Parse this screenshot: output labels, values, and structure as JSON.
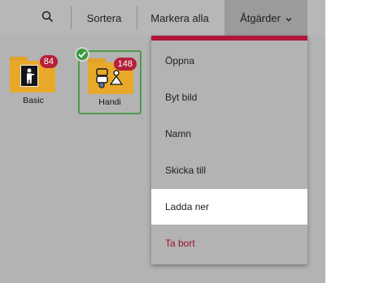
{
  "toolbar": {
    "search_icon": "search-icon",
    "sort_label": "Sortera",
    "mark_all_label": "Markera alla",
    "actions_label": "Åtgärder",
    "actions_icon": "chevron-down-icon"
  },
  "folders": [
    {
      "label": "Basic",
      "count": "84",
      "selected": false
    },
    {
      "label": "Handi",
      "count": "148",
      "selected": true
    }
  ],
  "actions_menu": {
    "items": [
      {
        "label": "Öppna"
      },
      {
        "label": "Byt bild"
      },
      {
        "label": "Namn"
      },
      {
        "label": "Skicka till"
      },
      {
        "label": "Ladda ner",
        "highlighted": true
      },
      {
        "label": "Ta bort",
        "danger": true
      }
    ],
    "accent_color": "#b0183a"
  },
  "colors": {
    "badge": "#b4203a",
    "selected_border": "#4c9a4c",
    "folder": "#e8a92a"
  }
}
